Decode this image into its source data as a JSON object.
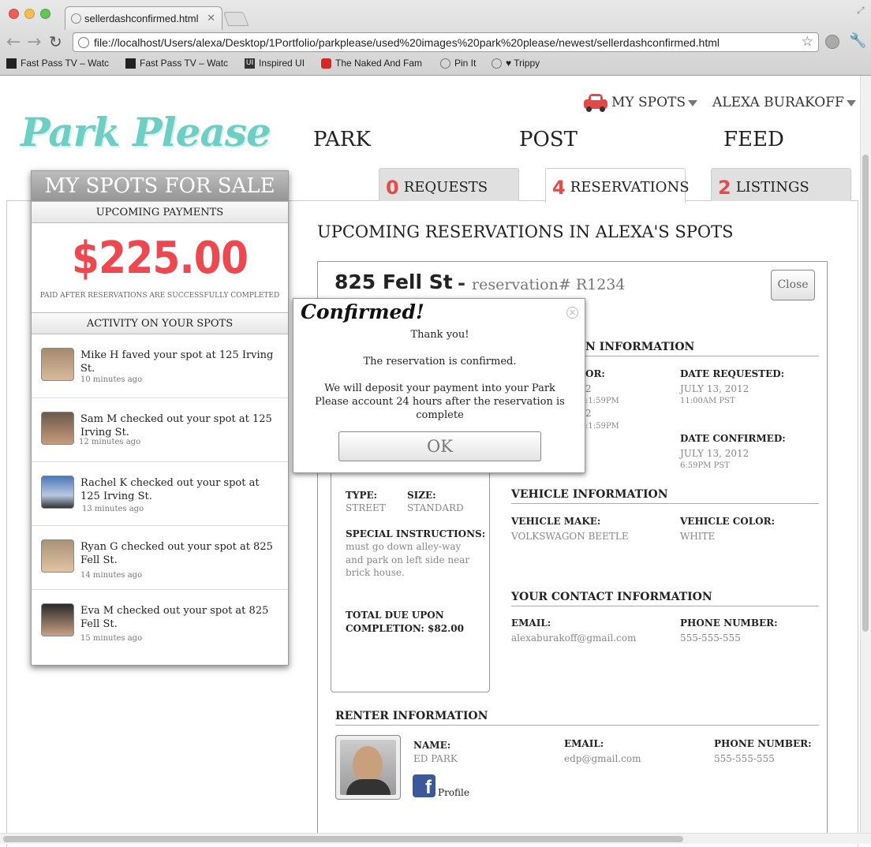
{
  "browser": {
    "tab_title": "sellerdashconfirmed.html",
    "url": "file://localhost/Users/alexa/Desktop/1Portfolio/parkplease/used%20images%20park%20please/newest/sellerdashconfirmed.html",
    "bookmarks": [
      "Fast Pass TV – Watc",
      "Fast Pass TV – Watc",
      "Inspired UI",
      "The Naked And Fam",
      "Pin It",
      "♥ Trippy"
    ]
  },
  "site": {
    "logo": "Park Please",
    "nav": [
      "PARK",
      "POST",
      "FEED"
    ],
    "my_spots": "MY SPOTS",
    "user": "ALEXA BURAKOFF"
  },
  "tabs": [
    {
      "count": "0",
      "label": "REQUESTS"
    },
    {
      "count": "4",
      "label": "RESERVATIONS"
    },
    {
      "count": "2",
      "label": "LISTINGS"
    }
  ],
  "sidebar": {
    "title": "MY SPOTS FOR SALE",
    "payments_header": "UPCOMING PAYMENTS",
    "amount": "$225.00",
    "paid_note": "PAID AFTER RESERVATIONS ARE SUCCESSFULLY COMPLETED",
    "activity_header": "ACTIVITY ON YOUR SPOTS",
    "activity": [
      {
        "text": "Mike H faved your spot at 125 Irving St.",
        "time": "10 minutes ago"
      },
      {
        "text": "Sam M checked out your spot at 125 Irving St.",
        "time": "12 minutes ago"
      },
      {
        "text": "Rachel K checked out your spot at 125 Irving St.",
        "time": "13 minutes ago"
      },
      {
        "text": "Ryan G checked out your spot at 825 Fell St.",
        "time": "14 minutes ago"
      },
      {
        "text": "Eva M checked out your spot at 825 Fell St.",
        "time": "15 minutes ago"
      }
    ]
  },
  "main": {
    "heading": "UPCOMING RESERVATIONS IN ALEXA'S SPOTS",
    "address": "825 Fell St",
    "dash": "-",
    "reservation_no": "reservation# R1234",
    "close": "Close",
    "reservation_info_header": "N INFORMATION",
    "partial_label": "OR:",
    "partial_vals": [
      "2",
      ":1:59PM",
      "2",
      ":1:59PM"
    ],
    "date_requested_label": "DATE REQUESTED:",
    "date_requested": "JULY 13, 2012",
    "time_requested": "11:00AM PST",
    "date_confirmed_label": "DATE CONFIRMED:",
    "date_confirmed": "JULY 13, 2012",
    "time_confirmed": "6:59PM PST",
    "type_label": "TYPE:",
    "type": "STREET",
    "size_label": "SIZE:",
    "size": "STANDARD",
    "special_label": "SPECIAL INSTRUCTIONS:",
    "special_lines": [
      "must go down alley-way",
      "and park on left side near",
      "brick house."
    ],
    "total_lines": [
      "TOTAL DUE UPON",
      "COMPLETION: $82.00"
    ],
    "vehicle_header": "VEHICLE INFORMATION",
    "make_label": "VEHICLE MAKE:",
    "make": "VOLKSWAGON BEETLE",
    "color_label": "VEHICLE COLOR:",
    "color": "WHITE",
    "contact_header": "YOUR CONTACT INFORMATION",
    "email_label": "EMAIL:",
    "email": "alexaburakoff@gmail.com",
    "phone_label": "PHONE NUMBER:",
    "phone": "555-555-555",
    "renter_header": "RENTER INFORMATION",
    "renter_name_label": "NAME:",
    "renter_name": "ED PARK",
    "renter_email_label": "EMAIL:",
    "renter_email": "edp@gmail.com",
    "renter_phone_label": "PHONE NUMBER:",
    "renter_phone": "555-555-555",
    "profile": "Profile",
    "fb_letter": "f"
  },
  "modal": {
    "title": "Confirmed!",
    "thanks": "Thank you!",
    "confirmed": "The reservation is confirmed.",
    "deposit_lines": [
      "We will deposit your payment into your Park",
      "Please account 24 hours after the reservation is",
      "complete"
    ],
    "ok": "OK"
  },
  "colors": {
    "accent_red": "#f0474f",
    "logo_teal": "#6ccfc4",
    "facebook": "#3b5998"
  }
}
